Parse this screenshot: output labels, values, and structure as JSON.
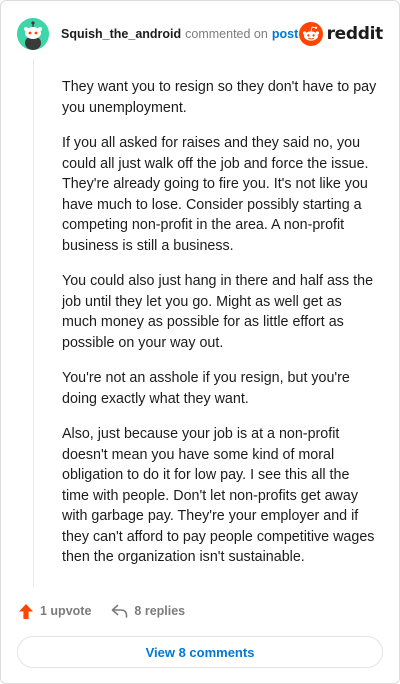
{
  "header": {
    "username": "Squish_the_android",
    "commented_text": "commented on",
    "post_link": "post",
    "brand_name": "reddit",
    "avatar_icon": "snoo-avatar-icon",
    "brand_icon": "reddit-logo-icon"
  },
  "comment": {
    "paragraphs": [
      "They want you to resign so they don't have to pay you unemployment.",
      "If you all asked for raises and they said no, you could all just walk off the job and force the issue. They're already going to fire you. It's not like you have much to lose. Consider possibly starting a competing non-profit in the area. A non-profit business is still a business.",
      "You could also just hang in there and half ass the job until they let you go. Might as well get as much money as possible for as little effort as possible on your way out.",
      "You're not an asshole if you resign, but you're doing exactly what they want.",
      "Also, just because your job is at a non-profit doesn't mean you have some kind of moral obligation to do it for low pay. I see this all the time with people. Don't let non-profits get away with garbage pay. They're your employer and if they can't afford to pay people competitive wages then the organization isn't sustainable."
    ]
  },
  "actions": {
    "upvote_label": "1 upvote",
    "replies_label": "8 replies",
    "upvote_icon": "upvote-arrow-icon",
    "reply_icon": "reply-arrow-icon"
  },
  "footer": {
    "view_comments_label": "View 8 comments"
  },
  "colors": {
    "avatar_bg": "#3dd6a8",
    "brand_orange": "#ff4500",
    "link_blue": "#0079d3",
    "upvote_orange": "#ff4500"
  }
}
